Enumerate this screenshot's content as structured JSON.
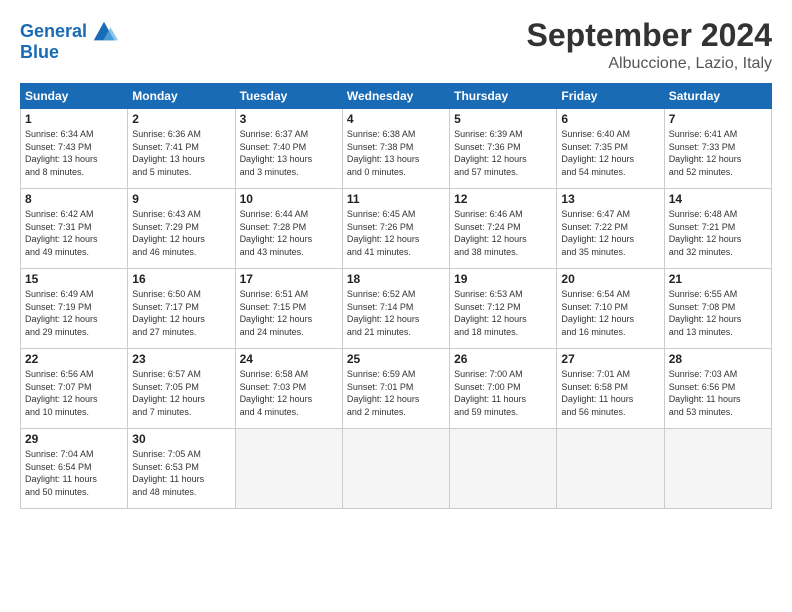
{
  "header": {
    "logo_line1": "General",
    "logo_line2": "Blue",
    "month": "September 2024",
    "location": "Albuccione, Lazio, Italy"
  },
  "weekdays": [
    "Sunday",
    "Monday",
    "Tuesday",
    "Wednesday",
    "Thursday",
    "Friday",
    "Saturday"
  ],
  "weeks": [
    [
      {
        "day": "1",
        "info": "Sunrise: 6:34 AM\nSunset: 7:43 PM\nDaylight: 13 hours\nand 8 minutes."
      },
      {
        "day": "2",
        "info": "Sunrise: 6:36 AM\nSunset: 7:41 PM\nDaylight: 13 hours\nand 5 minutes."
      },
      {
        "day": "3",
        "info": "Sunrise: 6:37 AM\nSunset: 7:40 PM\nDaylight: 13 hours\nand 3 minutes."
      },
      {
        "day": "4",
        "info": "Sunrise: 6:38 AM\nSunset: 7:38 PM\nDaylight: 13 hours\nand 0 minutes."
      },
      {
        "day": "5",
        "info": "Sunrise: 6:39 AM\nSunset: 7:36 PM\nDaylight: 12 hours\nand 57 minutes."
      },
      {
        "day": "6",
        "info": "Sunrise: 6:40 AM\nSunset: 7:35 PM\nDaylight: 12 hours\nand 54 minutes."
      },
      {
        "day": "7",
        "info": "Sunrise: 6:41 AM\nSunset: 7:33 PM\nDaylight: 12 hours\nand 52 minutes."
      }
    ],
    [
      {
        "day": "8",
        "info": "Sunrise: 6:42 AM\nSunset: 7:31 PM\nDaylight: 12 hours\nand 49 minutes."
      },
      {
        "day": "9",
        "info": "Sunrise: 6:43 AM\nSunset: 7:29 PM\nDaylight: 12 hours\nand 46 minutes."
      },
      {
        "day": "10",
        "info": "Sunrise: 6:44 AM\nSunset: 7:28 PM\nDaylight: 12 hours\nand 43 minutes."
      },
      {
        "day": "11",
        "info": "Sunrise: 6:45 AM\nSunset: 7:26 PM\nDaylight: 12 hours\nand 41 minutes."
      },
      {
        "day": "12",
        "info": "Sunrise: 6:46 AM\nSunset: 7:24 PM\nDaylight: 12 hours\nand 38 minutes."
      },
      {
        "day": "13",
        "info": "Sunrise: 6:47 AM\nSunset: 7:22 PM\nDaylight: 12 hours\nand 35 minutes."
      },
      {
        "day": "14",
        "info": "Sunrise: 6:48 AM\nSunset: 7:21 PM\nDaylight: 12 hours\nand 32 minutes."
      }
    ],
    [
      {
        "day": "15",
        "info": "Sunrise: 6:49 AM\nSunset: 7:19 PM\nDaylight: 12 hours\nand 29 minutes."
      },
      {
        "day": "16",
        "info": "Sunrise: 6:50 AM\nSunset: 7:17 PM\nDaylight: 12 hours\nand 27 minutes."
      },
      {
        "day": "17",
        "info": "Sunrise: 6:51 AM\nSunset: 7:15 PM\nDaylight: 12 hours\nand 24 minutes."
      },
      {
        "day": "18",
        "info": "Sunrise: 6:52 AM\nSunset: 7:14 PM\nDaylight: 12 hours\nand 21 minutes."
      },
      {
        "day": "19",
        "info": "Sunrise: 6:53 AM\nSunset: 7:12 PM\nDaylight: 12 hours\nand 18 minutes."
      },
      {
        "day": "20",
        "info": "Sunrise: 6:54 AM\nSunset: 7:10 PM\nDaylight: 12 hours\nand 16 minutes."
      },
      {
        "day": "21",
        "info": "Sunrise: 6:55 AM\nSunset: 7:08 PM\nDaylight: 12 hours\nand 13 minutes."
      }
    ],
    [
      {
        "day": "22",
        "info": "Sunrise: 6:56 AM\nSunset: 7:07 PM\nDaylight: 12 hours\nand 10 minutes."
      },
      {
        "day": "23",
        "info": "Sunrise: 6:57 AM\nSunset: 7:05 PM\nDaylight: 12 hours\nand 7 minutes."
      },
      {
        "day": "24",
        "info": "Sunrise: 6:58 AM\nSunset: 7:03 PM\nDaylight: 12 hours\nand 4 minutes."
      },
      {
        "day": "25",
        "info": "Sunrise: 6:59 AM\nSunset: 7:01 PM\nDaylight: 12 hours\nand 2 minutes."
      },
      {
        "day": "26",
        "info": "Sunrise: 7:00 AM\nSunset: 7:00 PM\nDaylight: 11 hours\nand 59 minutes."
      },
      {
        "day": "27",
        "info": "Sunrise: 7:01 AM\nSunset: 6:58 PM\nDaylight: 11 hours\nand 56 minutes."
      },
      {
        "day": "28",
        "info": "Sunrise: 7:03 AM\nSunset: 6:56 PM\nDaylight: 11 hours\nand 53 minutes."
      }
    ],
    [
      {
        "day": "29",
        "info": "Sunrise: 7:04 AM\nSunset: 6:54 PM\nDaylight: 11 hours\nand 50 minutes."
      },
      {
        "day": "30",
        "info": "Sunrise: 7:05 AM\nSunset: 6:53 PM\nDaylight: 11 hours\nand 48 minutes."
      },
      {
        "day": "",
        "info": ""
      },
      {
        "day": "",
        "info": ""
      },
      {
        "day": "",
        "info": ""
      },
      {
        "day": "",
        "info": ""
      },
      {
        "day": "",
        "info": ""
      }
    ]
  ]
}
